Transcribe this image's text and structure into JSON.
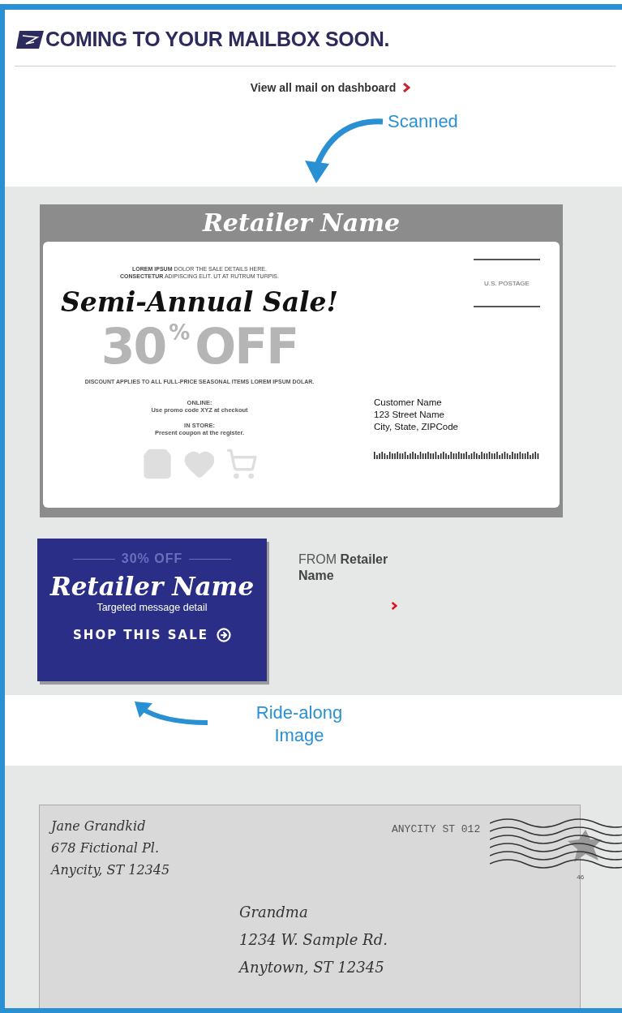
{
  "header": {
    "title": "COMING TO YOUR MAILBOX SOON.",
    "dashboard_link": "View all mail on dashboard"
  },
  "scanned_label": "Scanned",
  "mailpiece": {
    "retailer": "Retailer Name",
    "details": [
      "**LOREM IPSUM** DOLOR THE SALE DETAILS HERE.",
      "**CONSECTETUR** ADIPISCING ELIT. UT AT RUTRUM TURPIS."
    ],
    "headline": "Semi-Annual Sale!",
    "discount_number": "30",
    "discount_percent": "%",
    "discount_word": "OFF",
    "disclaimer": "DISCOUNT APPLIES TO ALL FULL-PRICE SEASONAL ITEMS LOREM IPSUM DOLAR.",
    "offers": [
      {
        "heading": "ONLINE:",
        "text": "Use promo code XYZ at checkout"
      },
      {
        "heading": "IN STORE:",
        "text": "Present coupon at the register."
      }
    ],
    "postage": "U.S. POSTAGE",
    "recipient": [
      "Customer Name",
      "123 Street Name",
      "City, State, ZIPCode"
    ]
  },
  "ride_along": {
    "discount": "30% OFF",
    "retailer": "Retailer Name",
    "message": "Targeted message detail",
    "cta": "SHOP THIS SALE",
    "from": "FROM **Retailer Name**"
  },
  "ride_along_label": "Ride-along Image",
  "envelope": {
    "return_address": [
      "Jane Grandkid",
      "678 Fictional Pl.",
      "Anycity, ST 12345"
    ],
    "postmark": "ANYCITY ST 012",
    "stamp_value": "46",
    "recipient": [
      "Grandma",
      "1234 W. Sample Rd.",
      "Anytown, ST 12345"
    ]
  }
}
